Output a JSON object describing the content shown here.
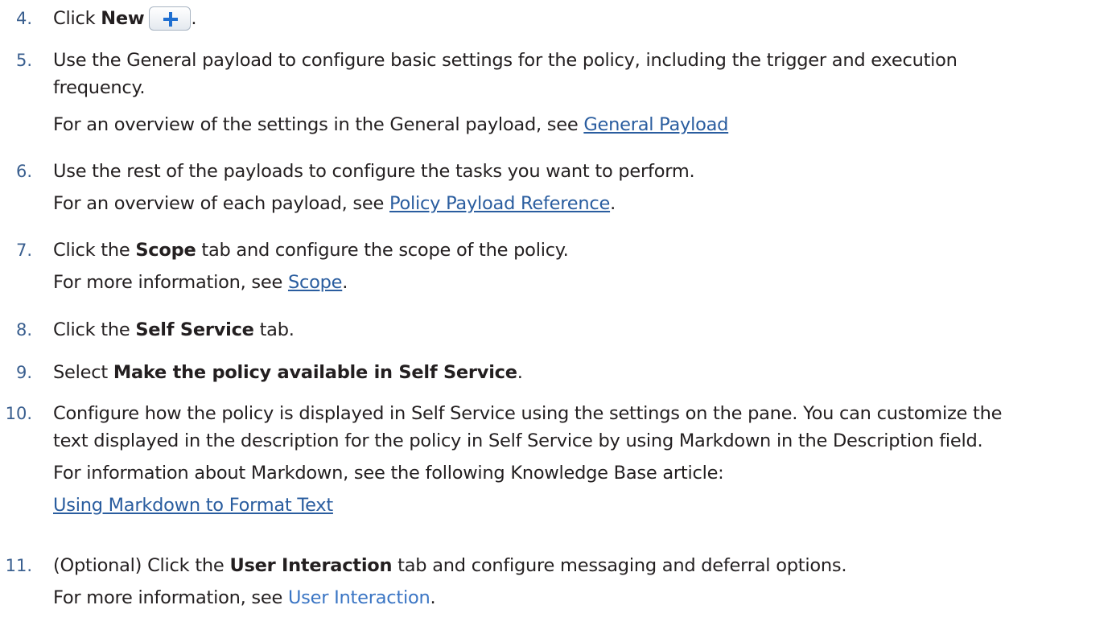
{
  "steps": [
    {
      "number": "4.",
      "text_before": "Click ",
      "bold": "New",
      "button_icon": "plus-icon",
      "text_after": "."
    },
    {
      "number": "5.",
      "line1": "Use the General payload to configure basic settings for the policy, including the trigger and execution",
      "line2": "frequency.",
      "sub_text": "For an overview of the settings in the General payload, see ",
      "sub_link": "General Payload"
    },
    {
      "number": "6.",
      "line1": "Use the rest of the payloads to configure the tasks you want to perform.",
      "sub_text": "For an overview of each payload, see ",
      "sub_link": "Policy Payload Reference",
      "sub_after": "."
    },
    {
      "number": "7.",
      "text_before": "Click the ",
      "bold": "Scope",
      "text_after": " tab and configure the scope of the policy.",
      "sub_text": "For more information, see ",
      "sub_link": "Scope",
      "sub_after": "."
    },
    {
      "number": "8.",
      "text_before": "Click the ",
      "bold": "Self Service",
      "text_after": " tab."
    },
    {
      "number": "9.",
      "text_before": "Select ",
      "bold": "Make the policy available in Self Service",
      "text_after": "."
    },
    {
      "number": "10.",
      "line1": "Configure how the policy is displayed in Self Service using the settings on the pane. You can customize the",
      "line2": "text displayed in the description for the policy in Self Service by using Markdown in the Description field.",
      "sub_text": "For information about Markdown, see the following Knowledge Base article:",
      "sub_link": "Using Markdown to Format Text"
    },
    {
      "number": "11.",
      "text_before": "(Optional) Click the ",
      "bold": "User Interaction",
      "text_after": " tab and configure messaging and deferral options.",
      "sub_text": "For more information, see ",
      "sub_link": "User Interaction",
      "sub_after": "."
    }
  ],
  "colors": {
    "text": "#231f20",
    "step_number": "#3a5f8f",
    "link": "#2a5d9f",
    "plain_link": "#3a75c4",
    "plus_icon": "#1f6fd1"
  }
}
